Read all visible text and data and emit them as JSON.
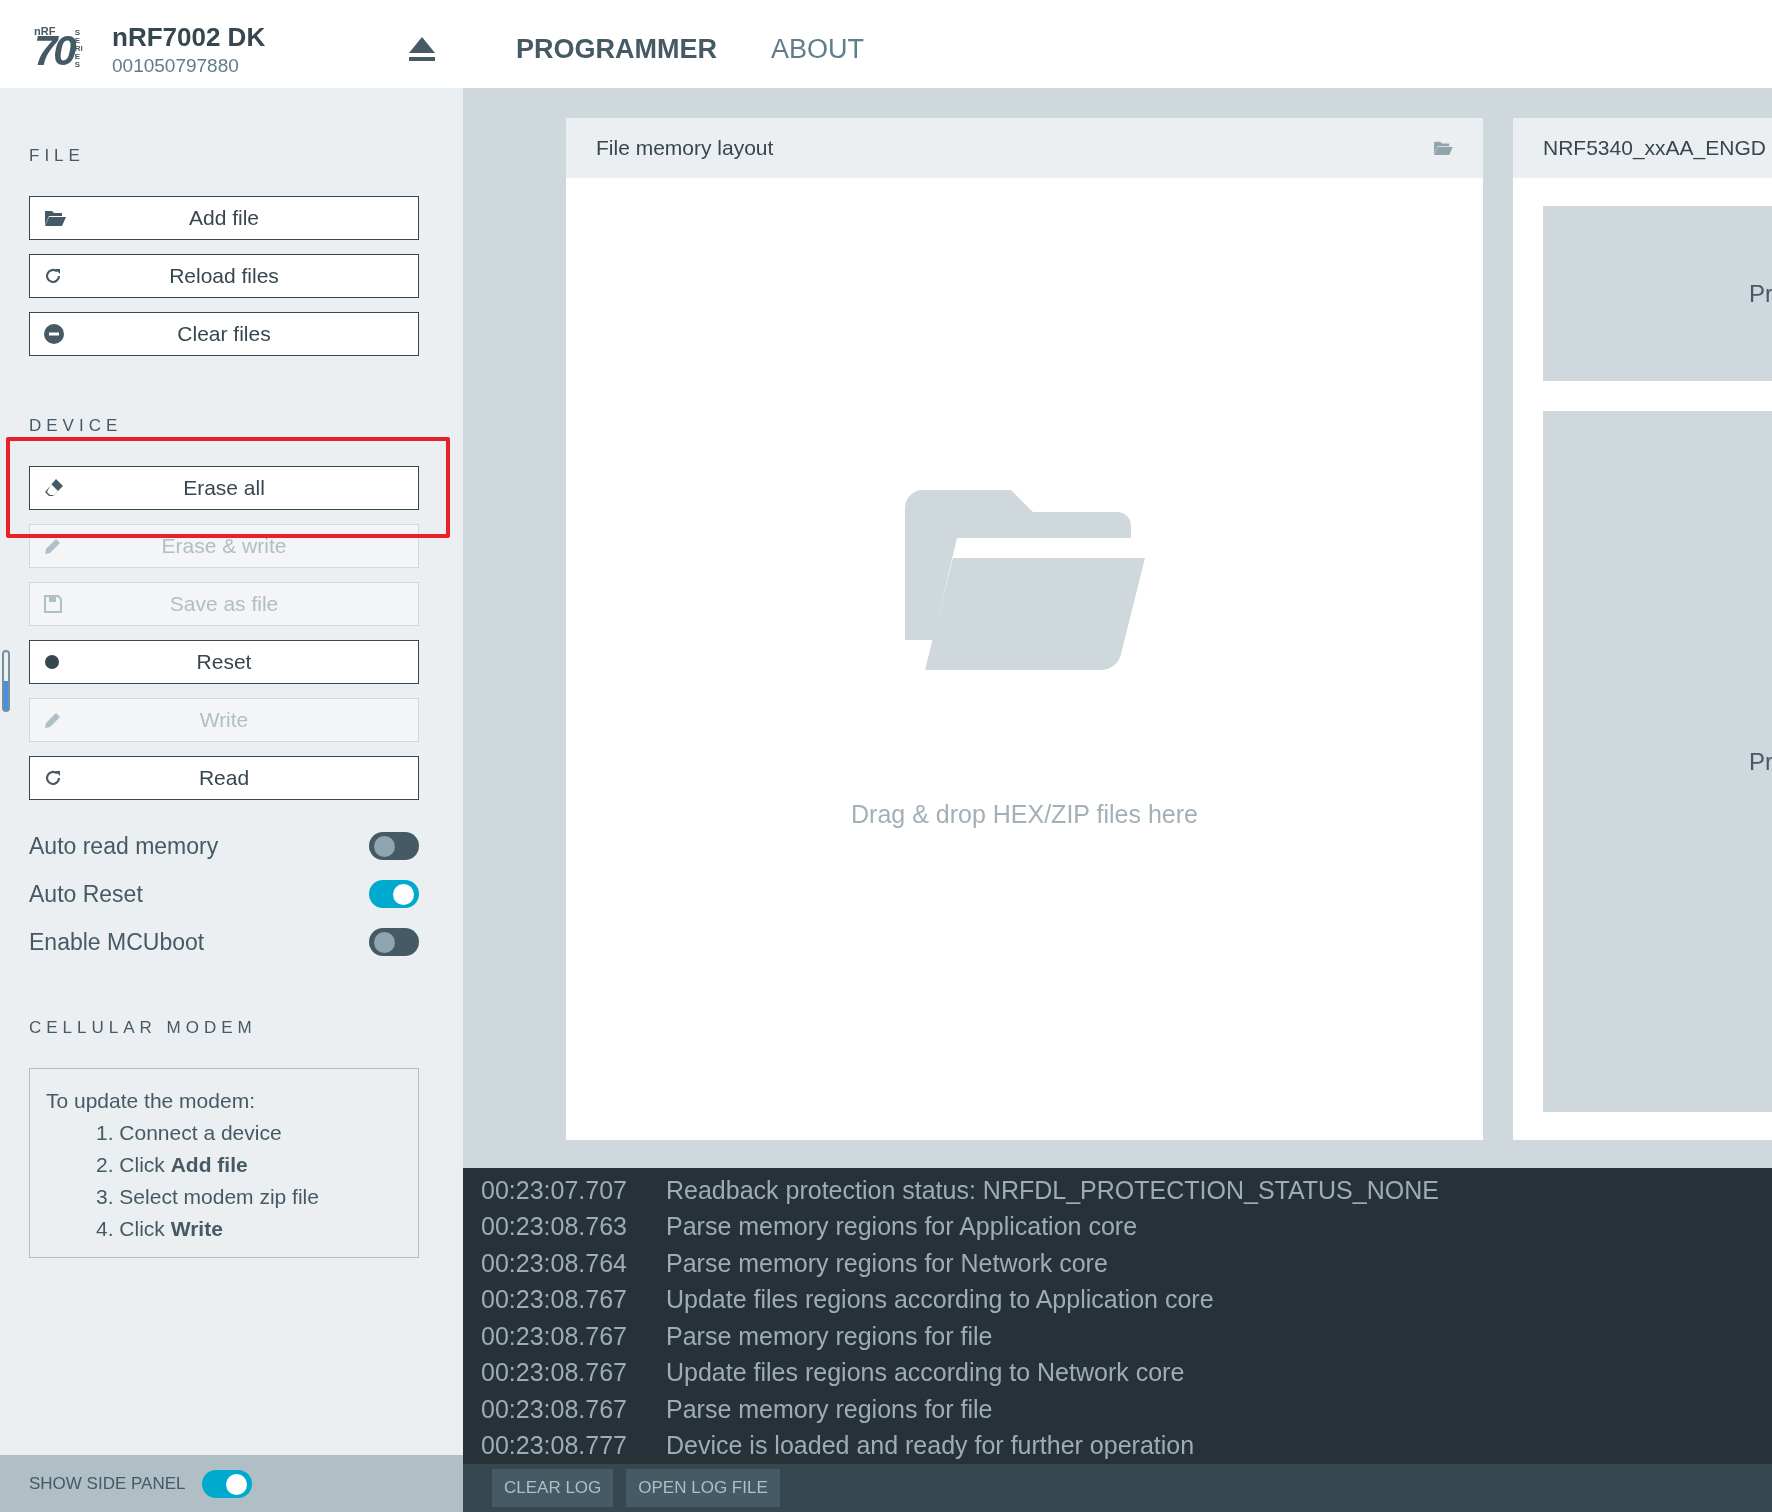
{
  "header": {
    "logo": {
      "brand": "nRF",
      "model": "70",
      "series": "SERIES"
    },
    "device_name": "nRF7002 DK",
    "serial": "001050797880",
    "nav": [
      {
        "label": "PROGRAMMER",
        "selected": true
      },
      {
        "label": "ABOUT",
        "selected": false
      }
    ]
  },
  "sidebar": {
    "file": {
      "title": "FILE",
      "buttons": [
        {
          "label": "Add file",
          "kind": "folder",
          "disabled": false
        },
        {
          "label": "Reload files",
          "kind": "reload",
          "disabled": false
        },
        {
          "label": "Clear files",
          "kind": "minus",
          "disabled": false
        }
      ]
    },
    "device": {
      "title": "DEVICE",
      "buttons": [
        {
          "label": "Erase all",
          "kind": "eraser",
          "disabled": false
        },
        {
          "label": "Erase & write",
          "kind": "pencil",
          "disabled": true
        },
        {
          "label": "Save as file",
          "kind": "floppy",
          "disabled": true
        },
        {
          "label": "Reset",
          "kind": "dot",
          "disabled": false
        },
        {
          "label": "Write",
          "kind": "pencil",
          "disabled": true
        },
        {
          "label": "Read",
          "kind": "reload",
          "disabled": false
        }
      ],
      "toggles": [
        {
          "label": "Auto read memory",
          "on": false
        },
        {
          "label": "Auto Reset",
          "on": true
        },
        {
          "label": "Enable MCUboot",
          "on": false
        }
      ]
    },
    "cellular_modem": {
      "title": "CELLULAR MODEM",
      "intro": "To update the modem:",
      "steps": [
        "1. Connect a device",
        "2. Click **Add file**",
        "3. Select modem zip file",
        "4. Click **Write**"
      ]
    },
    "show_side_panel": {
      "label": "SHOW SIDE PANEL",
      "on": true
    }
  },
  "file_memory_layout": {
    "title": "File memory layout",
    "drop_hint": "Drag & drop HEX/ZIP files here"
  },
  "device_memory_layout": {
    "title": "NRF5340_xxAA_ENGD",
    "regions": [
      "Pr",
      "Pr"
    ]
  },
  "log": {
    "entries": [
      {
        "time": "00:23:07.707",
        "message": "Readback protection status: NRFDL_PROTECTION_STATUS_NONE"
      },
      {
        "time": "00:23:08.763",
        "message": "Parse memory regions for Application core"
      },
      {
        "time": "00:23:08.764",
        "message": "Parse memory regions for Network core"
      },
      {
        "time": "00:23:08.767",
        "message": "Update files regions according to Application core"
      },
      {
        "time": "00:23:08.767",
        "message": "Parse memory regions for file"
      },
      {
        "time": "00:23:08.767",
        "message": "Update files regions according to Network core"
      },
      {
        "time": "00:23:08.767",
        "message": "Parse memory regions for file"
      },
      {
        "time": "00:23:08.777",
        "message": "Device is loaded and ready for further operation"
      }
    ],
    "buttons": [
      "CLEAR LOG",
      "OPEN LOG FILE"
    ]
  }
}
